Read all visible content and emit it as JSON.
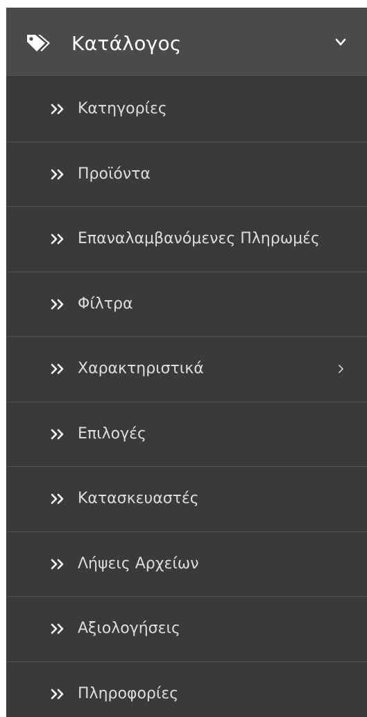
{
  "menu": {
    "header": {
      "label": "Κατάλογος",
      "icon": "tags-icon",
      "chevron": "chevron-down-icon"
    },
    "items": [
      {
        "label": "Κατηγορίες",
        "icon": "double-chevron-right-icon",
        "has_submenu": false
      },
      {
        "label": "Προϊόντα",
        "icon": "double-chevron-right-icon",
        "has_submenu": false
      },
      {
        "label": "Επαναλαμβανόμενες Πληρωμές",
        "icon": "double-chevron-right-icon",
        "has_submenu": false
      },
      {
        "label": "Φίλτρα",
        "icon": "double-chevron-right-icon",
        "has_submenu": false
      },
      {
        "label": "Χαρακτηριστικά",
        "icon": "double-chevron-right-icon",
        "has_submenu": true,
        "submenu_icon": "chevron-right-icon"
      },
      {
        "label": "Επιλογές",
        "icon": "double-chevron-right-icon",
        "has_submenu": false
      },
      {
        "label": "Κατασκευαστές",
        "icon": "double-chevron-right-icon",
        "has_submenu": false
      },
      {
        "label": "Λήψεις Αρχείων",
        "icon": "double-chevron-right-icon",
        "has_submenu": false
      },
      {
        "label": "Αξιολογήσεις",
        "icon": "double-chevron-right-icon",
        "has_submenu": false
      },
      {
        "label": "Πληροφορίες",
        "icon": "double-chevron-right-icon",
        "has_submenu": false
      }
    ]
  },
  "colors": {
    "background": "#3a3a3a",
    "header_background": "#4a4a4a",
    "header_text": "#ffffff",
    "item_text": "#dddddd",
    "divider": "#555555"
  }
}
